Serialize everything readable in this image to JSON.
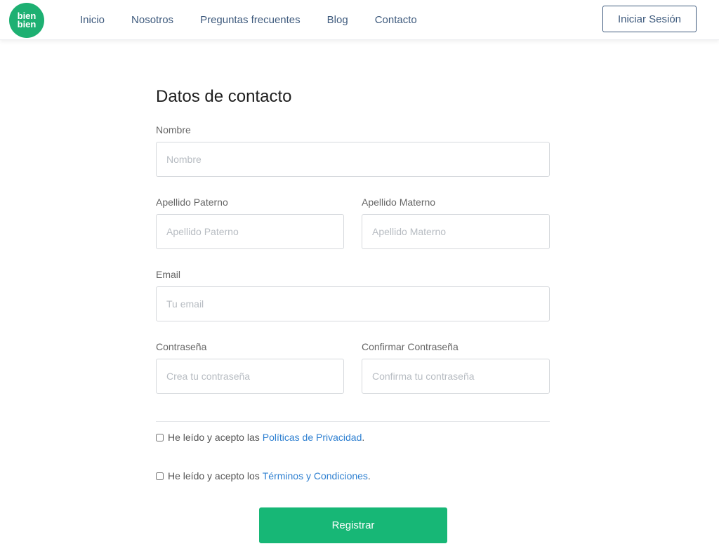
{
  "brand": {
    "logo_top": "bien",
    "logo_bottom": "bien"
  },
  "nav": {
    "items": [
      {
        "label": "Inicio"
      },
      {
        "label": "Nosotros"
      },
      {
        "label": "Preguntas frecuentes"
      },
      {
        "label": "Blog"
      },
      {
        "label": "Contacto"
      }
    ],
    "login_label": "Iniciar Sesión"
  },
  "form": {
    "title": "Datos de contacto",
    "nombre": {
      "label": "Nombre",
      "placeholder": "Nombre"
    },
    "apellido_paterno": {
      "label": "Apellido Paterno",
      "placeholder": "Apellido Paterno"
    },
    "apellido_materno": {
      "label": "Apellido Materno",
      "placeholder": "Apellido Materno"
    },
    "email": {
      "label": "Email",
      "placeholder": "Tu email"
    },
    "password": {
      "label": "Contraseña",
      "placeholder": "Crea tu contraseña"
    },
    "confirm_password": {
      "label": "Confirmar Contraseña",
      "placeholder": "Confirma tu contraseña"
    },
    "privacy": {
      "text": "He leído y acepto las",
      "link": "Políticas de Privacidad",
      "suffix": "."
    },
    "terms": {
      "text": "He leído y acepto los",
      "link": "Términos y Condiciones",
      "suffix": "."
    },
    "submit_label": "Registrar"
  },
  "colors": {
    "brand_green": "#1db072",
    "button_green": "#17b776",
    "nav_text": "#3e5a7d",
    "link_blue": "#2f80d1"
  }
}
